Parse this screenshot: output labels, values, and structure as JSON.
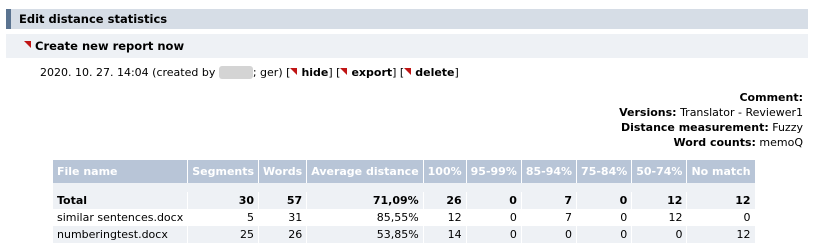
{
  "header": {
    "title": "Edit distance statistics"
  },
  "create_link": "Create new report now",
  "report": {
    "date": "2020. 10. 27. 14:04 (created by",
    "after_user": "; ger)",
    "actions": [
      {
        "label": "hide"
      },
      {
        "label": "export"
      },
      {
        "label": "delete"
      }
    ]
  },
  "meta": {
    "comment_label": "Comment:",
    "comment_value": "",
    "versions_label": "Versions:",
    "versions_value": "Translator - Reviewer1",
    "distance_label": "Distance measurement:",
    "distance_value": "Fuzzy",
    "wordcounts_label": "Word counts:",
    "wordcounts_value": "memoQ"
  },
  "table": {
    "columns": [
      "File name",
      "Segments",
      "Words",
      "Average distance",
      "100%",
      "95-99%",
      "85-94%",
      "75-84%",
      "50-74%",
      "No match"
    ],
    "rows": [
      [
        "Total",
        "30",
        "57",
        "71,09%",
        "26",
        "0",
        "7",
        "0",
        "12",
        "12"
      ],
      [
        "similar sentences.docx",
        "5",
        "31",
        "85,55%",
        "12",
        "0",
        "7",
        "0",
        "12",
        "0"
      ],
      [
        "numberingtest.docx",
        "25",
        "26",
        "53,85%",
        "14",
        "0",
        "0",
        "0",
        "0",
        "12"
      ]
    ]
  },
  "colors": {
    "header_accent": "#5a7390",
    "table_header": "#b8c5d7",
    "link_triangle": "#c01515"
  }
}
